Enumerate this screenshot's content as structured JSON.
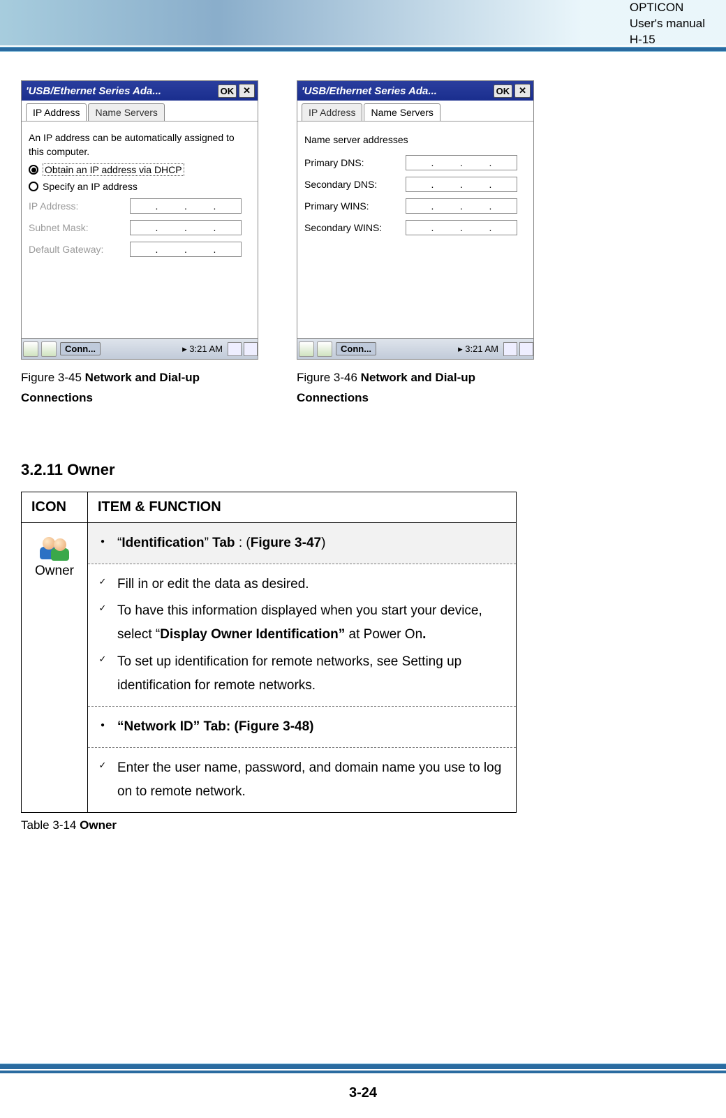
{
  "header": {
    "l1": "OPTICON",
    "l2": "User's manual",
    "l3": "H-15"
  },
  "fig_left": {
    "caption_prefix": "Figure 3-45 ",
    "caption_bold": "Network and Dial-up Connections",
    "title": "'USB/Ethernet Series Ada...",
    "ok": "OK",
    "tab_active": "IP Address",
    "tab_other": "Name Servers",
    "text_auto": "An IP address can be automatically assigned to this computer.",
    "radio_dhcp": "Obtain an IP address via DHCP",
    "radio_spec": "Specify an IP address",
    "lbl_ip": "IP Address:",
    "lbl_mask": "Subnet Mask:",
    "lbl_gw": "Default Gateway:",
    "task_btn": "Conn...",
    "task_time": "3:21 AM"
  },
  "fig_right": {
    "caption_prefix": "Figure 3-46 ",
    "caption_bold": "Network and Dial-up Connections",
    "title": "'USB/Ethernet Series Ada...",
    "ok": "OK",
    "tab_other": "IP Address",
    "tab_active": "Name Servers",
    "heading": "Name server addresses",
    "lbl_pdns": "Primary DNS:",
    "lbl_sdns": "Secondary DNS:",
    "lbl_pwins": "Primary WINS:",
    "lbl_swins": "Secondary WINS:",
    "task_btn": "Conn...",
    "task_time": "3:21 AM"
  },
  "section_title": "3.2.11 Owner",
  "table": {
    "h_icon": "ICON",
    "h_item": "ITEM & FUNCTION",
    "icon_label": "Owner",
    "r1_a": "“",
    "r1_b": "Identification",
    "r1_c": "” ",
    "r1_d": "Tab",
    "r1_e": " : (",
    "r1_f": "Figure 3-47",
    "r1_g": ")",
    "r2": "Fill in or edit the data as desired.",
    "r3_a": "To have this information displayed when you start your device, select “",
    "r3_b": "Display Owner Identification”",
    "r3_c": " at Power On",
    "r3_d": ".",
    "r4": "To set up identification for remote networks, see Setting up identification for remote networks.",
    "r5": "“Network ID” Tab: (Figure 3-48)",
    "r6": "Enter the user name, password, and domain name you use to log on to remote network."
  },
  "table_caption_prefix": "Table 3-14 ",
  "table_caption_bold": "Owner",
  "page_num": "3-24"
}
